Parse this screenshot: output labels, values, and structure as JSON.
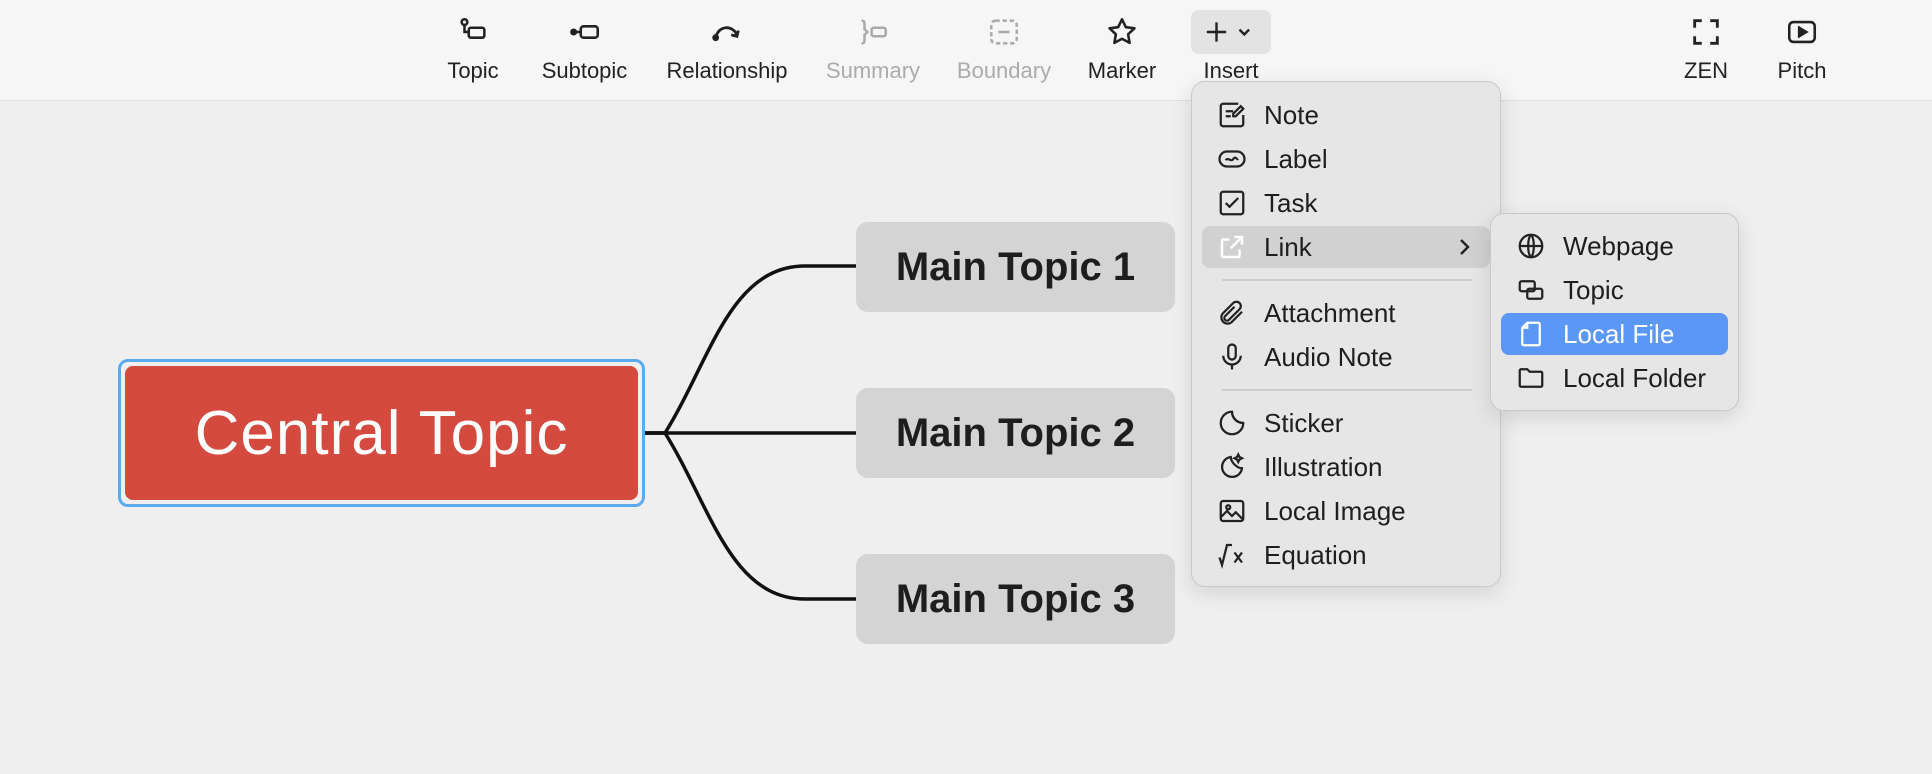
{
  "toolbar": {
    "topic": "Topic",
    "subtopic": "Subtopic",
    "relationship": "Relationship",
    "summary": "Summary",
    "boundary": "Boundary",
    "marker": "Marker",
    "insert": "Insert",
    "zen": "ZEN",
    "pitch": "Pitch"
  },
  "map": {
    "central": "Central Topic",
    "main_topics": [
      "Main Topic 1",
      "Main Topic 2",
      "Main Topic 3"
    ]
  },
  "insert_menu": {
    "items": [
      "Note",
      "Label",
      "Task",
      "Link",
      "Attachment",
      "Audio Note",
      "Sticker",
      "Illustration",
      "Local Image",
      "Equation"
    ]
  },
  "link_submenu": {
    "items": [
      "Webpage",
      "Topic",
      "Local File",
      "Local Folder"
    ],
    "selected": "Local File"
  },
  "colors": {
    "central_fill": "#d44a3f",
    "selection_border": "#5aaaf0",
    "menu_selected": "#5b97f5"
  }
}
